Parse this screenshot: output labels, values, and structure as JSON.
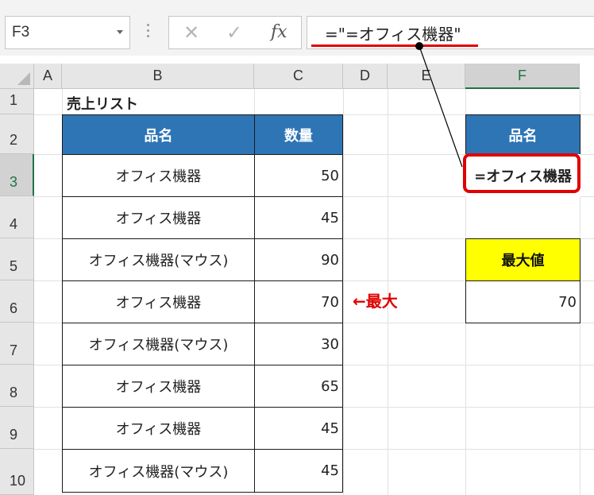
{
  "name_box": {
    "value": "F3"
  },
  "formula_buttons": {
    "cancel": "✕",
    "enter": "✓",
    "fx": "fx"
  },
  "formula_bar": {
    "value": "=\"=オフィス機器\""
  },
  "columns": [
    "A",
    "B",
    "C",
    "D",
    "E",
    "F"
  ],
  "rows": [
    "1",
    "2",
    "3",
    "4",
    "5",
    "6",
    "7",
    "8",
    "9",
    "10"
  ],
  "sheet": {
    "title": "売上リスト",
    "table_headers": {
      "item": "品名",
      "qty": "数量"
    },
    "table_rows": [
      {
        "item": "オフィス機器",
        "qty": "50"
      },
      {
        "item": "オフィス機器",
        "qty": "45"
      },
      {
        "item": "オフィス機器(マウス)",
        "qty": "90"
      },
      {
        "item": "オフィス機器",
        "qty": "70"
      },
      {
        "item": "オフィス機器(マウス)",
        "qty": "30"
      },
      {
        "item": "オフィス機器",
        "qty": "65"
      },
      {
        "item": "オフィス機器",
        "qty": "45"
      },
      {
        "item": "オフィス機器(マウス)",
        "qty": "45"
      }
    ],
    "criteria_header": "品名",
    "criteria_value": "=オフィス機器",
    "max_label": "最大値",
    "max_value": "70"
  },
  "annotation": "←最大",
  "colors": {
    "header_blue": "#2e75b6",
    "highlight_yellow": "#ffff00",
    "annotation_red": "#e00000",
    "excel_green": "#217346"
  }
}
